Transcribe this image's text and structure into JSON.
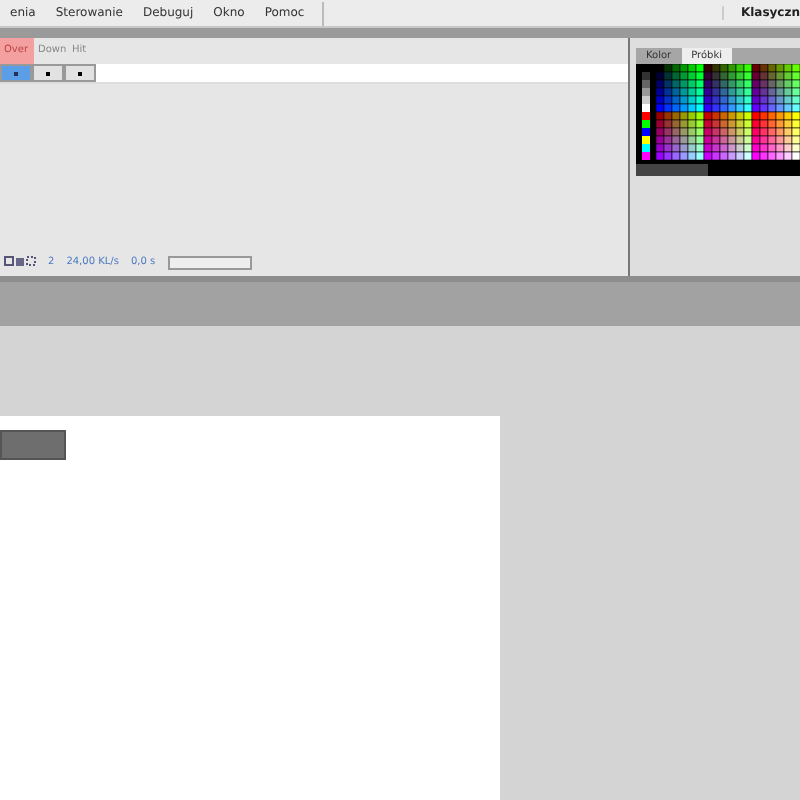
{
  "menu": [
    "enia",
    "Sterowanie",
    "Debuguj",
    "Okno",
    "Pomoc"
  ],
  "workspace": "Klasyczn",
  "timeline": {
    "frames": [
      {
        "label": "Over",
        "selected": true
      },
      {
        "label": "Down",
        "selected": false
      },
      {
        "label": "Hit",
        "selected": false
      }
    ],
    "status": {
      "frame": "2",
      "fps": "24,00 KL/s",
      "time": "0,0 s"
    }
  },
  "panel": {
    "tabs": [
      {
        "label": "Kolor",
        "selected": false
      },
      {
        "label": "Próbki",
        "selected": true
      }
    ]
  }
}
